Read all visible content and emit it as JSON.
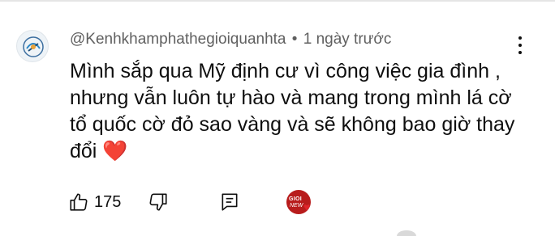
{
  "comment": {
    "author": "@Kenhkhamphathegioiquanhta",
    "separator": "•",
    "timestamp": "1 ngày trước",
    "text": "Mình sắp qua Mỹ định cư vì công việc gia đình , nhưng vẫn luôn tự hào  và mang trong mình lá cờ tổ quốc cờ đỏ sao vàng và sẽ không bao giờ thay đổi",
    "emoji": "❤️"
  },
  "actions": {
    "like_count": "175"
  },
  "icons": {
    "avatar": "channel-avatar",
    "more": "more-vert-icon",
    "like": "thumbs-up-icon",
    "dislike": "thumbs-down-icon",
    "reply": "comment-reply-icon",
    "creator_heart": "creator-heart-badge"
  },
  "colors": {
    "meta_text": "#606060",
    "body_text": "#0f0f0f",
    "heart": "#e0252c",
    "creator_badge": "#b81c1c"
  },
  "creator_badge": {
    "line1": "GIOI",
    "line2": "NEW"
  }
}
